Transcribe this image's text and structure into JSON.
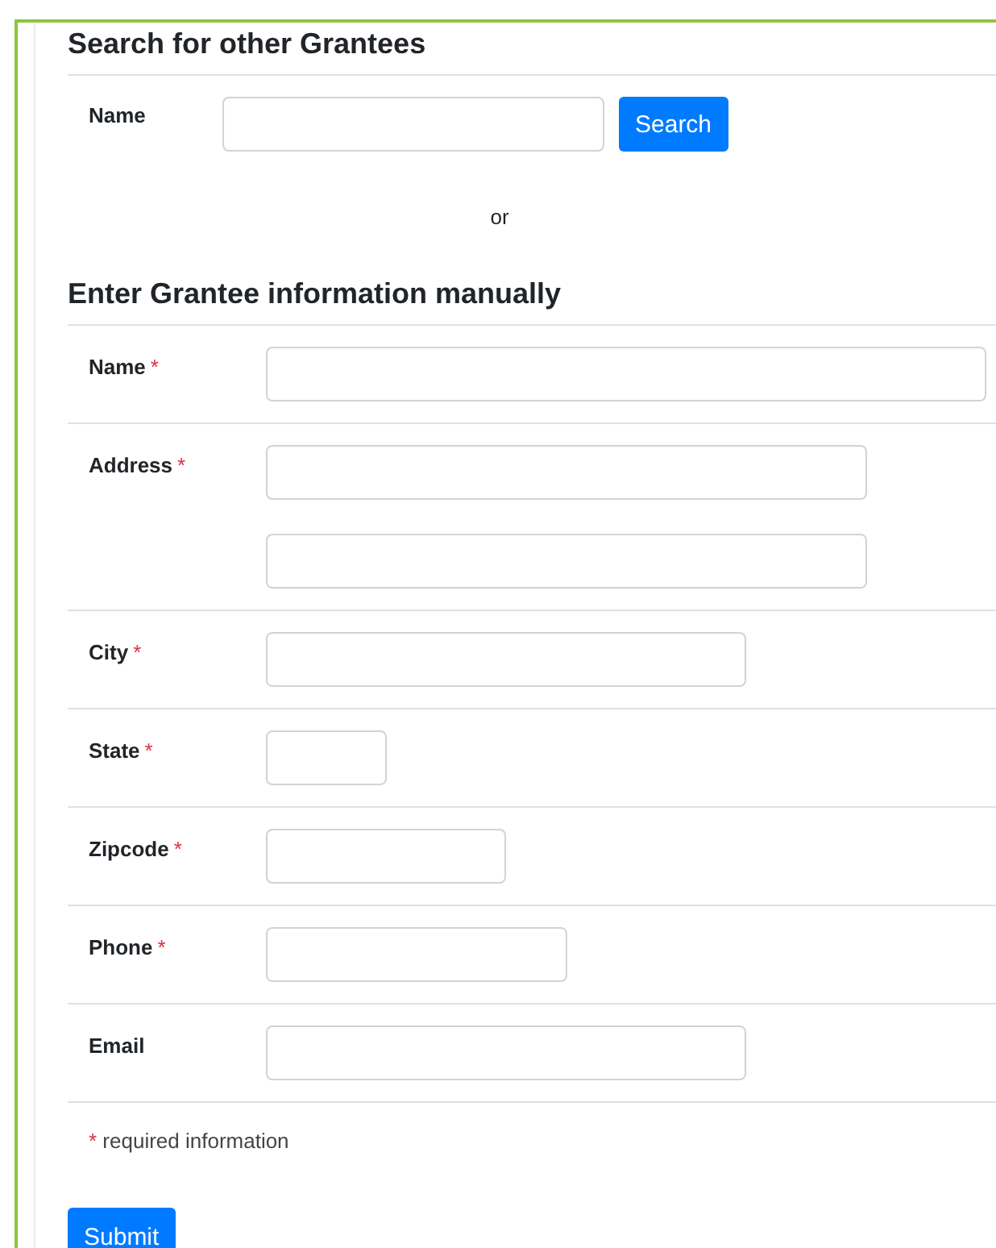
{
  "search_section": {
    "title": "Search for other Grantees",
    "label": "Name",
    "button": "Search"
  },
  "separator": "or",
  "manual_section": {
    "title": "Enter Grantee information manually",
    "required_mark": "*",
    "fields": [
      {
        "label": "Name",
        "required": true,
        "inputs": [
          {
            "kind": "text"
          }
        ]
      },
      {
        "label": "Address",
        "required": true,
        "inputs": [
          {
            "kind": "text"
          },
          {
            "kind": "text"
          }
        ]
      },
      {
        "label": "City",
        "required": true,
        "inputs": [
          {
            "kind": "text"
          }
        ]
      },
      {
        "label": "State",
        "required": true,
        "inputs": [
          {
            "kind": "text"
          }
        ]
      },
      {
        "label": "Zipcode",
        "required": true,
        "inputs": [
          {
            "kind": "text"
          }
        ]
      },
      {
        "label": "Phone",
        "required": true,
        "inputs": [
          {
            "kind": "text"
          }
        ]
      },
      {
        "label": "Email",
        "required": false,
        "inputs": [
          {
            "kind": "text"
          }
        ]
      }
    ],
    "required_note": "required information"
  },
  "submit_button": "Submit"
}
